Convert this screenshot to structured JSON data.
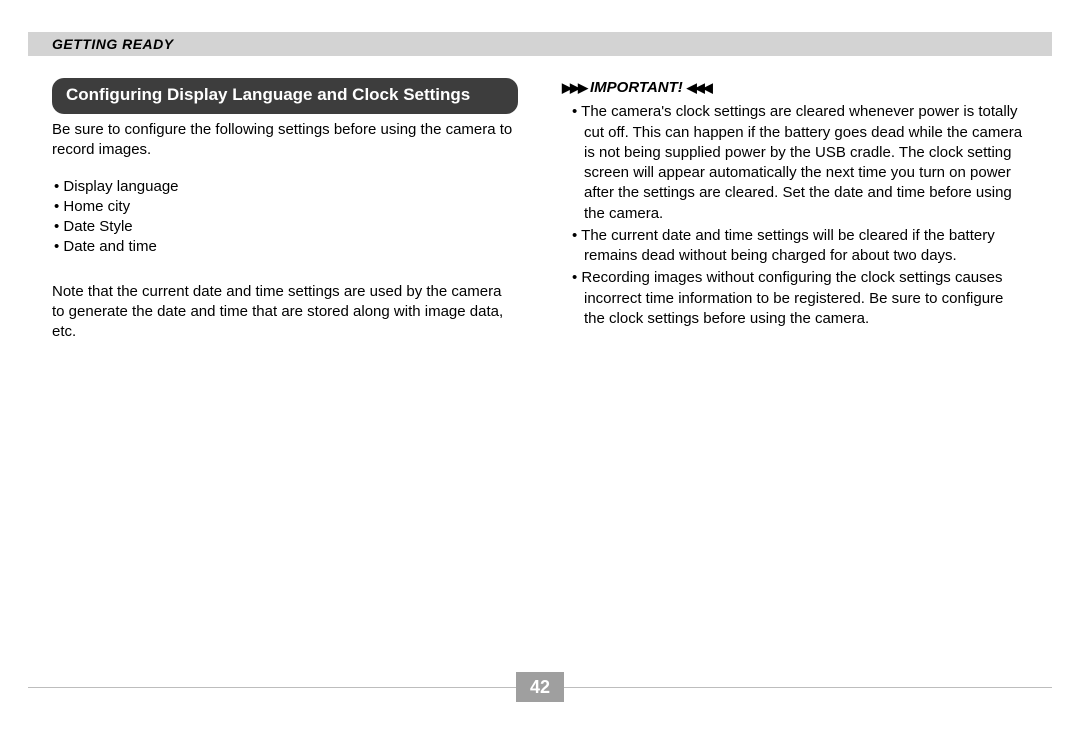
{
  "chapter": "GETTING READY",
  "left": {
    "section_title": "Configuring Display Language and Clock Settings",
    "intro": "Be sure to configure the following settings before using the camera to record images.",
    "bullets": [
      "Display language",
      "Home city",
      "Date Style",
      "Date and time"
    ],
    "note": "Note that the current date and time settings are used by the camera to generate the date and time that are stored along with image data, etc."
  },
  "right": {
    "important_label": "IMPORTANT!",
    "arrows_left": "▶▶▶",
    "arrows_right": "◀◀◀",
    "items": [
      "The camera's clock settings are cleared whenever power is totally cut off. This can happen if the battery goes dead while the camera is not being supplied power by the USB cradle. The clock setting screen will appear automatically the next time you turn on power after the settings are cleared. Set the date and time before using the camera.",
      "The current date and time settings will be cleared if the battery remains dead without being charged for about two days.",
      "Recording images without configuring the clock settings causes incorrect time information to be registered. Be sure to configure the clock settings before using the camera."
    ]
  },
  "page_number": "42"
}
